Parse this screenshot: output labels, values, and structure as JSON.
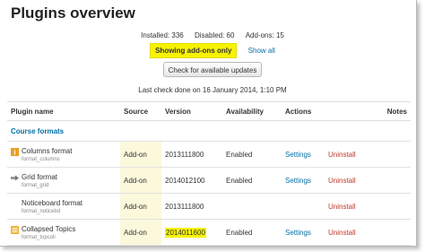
{
  "title": "Plugins overview",
  "counts": {
    "installed": "Installed: 336",
    "disabled": "Disabled: 60",
    "addons": "Add-ons: 15"
  },
  "filter": {
    "active": "Showing add-ons only",
    "show_all": "Show all"
  },
  "check_button": "Check for available updates",
  "last_check": "Last check done on 16 January 2014, 1:10 PM",
  "table": {
    "headers": [
      "Plugin name",
      "Source",
      "Version",
      "Availability",
      "Actions",
      "",
      "Notes"
    ],
    "category": "Course formats",
    "rows": [
      {
        "name": "Columns format",
        "component": "format_columns",
        "icon": "columns-format-icon",
        "source": "Add-on",
        "version": "2013111800",
        "availability": "Enabled",
        "settings": "Settings",
        "uninstall": "Uninstall"
      },
      {
        "name": "Grid format",
        "component": "format_grid",
        "icon": "grid-format-icon",
        "source": "Add-on",
        "version": "2014012100",
        "availability": "Enabled",
        "settings": "Settings",
        "uninstall": "Uninstall"
      },
      {
        "name": "Noticeboard format",
        "component": "format_noticebd",
        "icon": "",
        "source": "Add-on",
        "version": "2013111800",
        "availability": "",
        "settings": "",
        "uninstall": "Uninstall"
      },
      {
        "name": "Collapsed Topics",
        "component": "format_topcoll",
        "icon": "collapsed-topics-icon",
        "source": "Add-on",
        "version": "2014011600",
        "availability": "Enabled",
        "settings": "Settings",
        "uninstall": "Uninstall"
      }
    ]
  },
  "colors": {
    "highlight": "#f7f300",
    "link": "#0070a8",
    "uninstall": "#c0392b",
    "source_bg": "#fcf8dc"
  }
}
